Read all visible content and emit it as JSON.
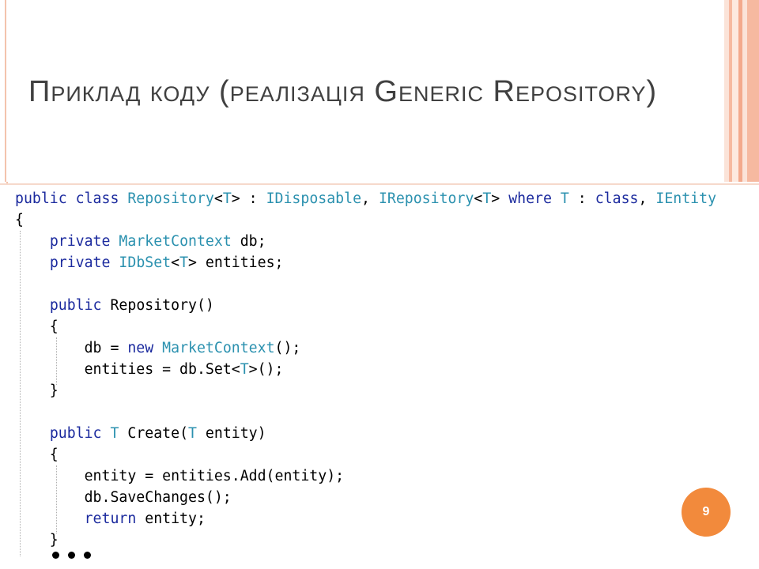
{
  "slide": {
    "title": "Приклад коду (реалізація Generic Repository)",
    "page_number": "9"
  },
  "code": {
    "lines": [
      [
        [
          "public",
          "kw"
        ],
        [
          " ",
          ""
        ],
        [
          "class",
          "kw"
        ],
        [
          " ",
          ""
        ],
        [
          "Repository",
          "ty"
        ],
        [
          "<",
          ""
        ],
        [
          "T",
          "ty"
        ],
        [
          "> : ",
          ""
        ],
        [
          "IDisposable",
          "ty"
        ],
        [
          ", ",
          ""
        ],
        [
          "IRepository",
          "ty"
        ],
        [
          "<",
          ""
        ],
        [
          "T",
          "ty"
        ],
        [
          "> ",
          ""
        ],
        [
          "where",
          "kw"
        ],
        [
          " ",
          ""
        ],
        [
          "T",
          "ty"
        ],
        [
          " : ",
          ""
        ],
        [
          "class",
          "kw"
        ],
        [
          ", ",
          ""
        ],
        [
          "IEntity",
          "ty"
        ]
      ],
      [
        [
          "{",
          ""
        ]
      ],
      [
        [
          "    ",
          ""
        ],
        [
          "private",
          "kw"
        ],
        [
          " ",
          ""
        ],
        [
          "MarketContext",
          "ty"
        ],
        [
          " db;",
          ""
        ]
      ],
      [
        [
          "    ",
          ""
        ],
        [
          "private",
          "kw"
        ],
        [
          " ",
          ""
        ],
        [
          "IDbSet",
          "ty"
        ],
        [
          "<",
          ""
        ],
        [
          "T",
          "ty"
        ],
        [
          "> entities;",
          ""
        ]
      ],
      [
        [
          "",
          ""
        ]
      ],
      [
        [
          "    ",
          ""
        ],
        [
          "public",
          "kw"
        ],
        [
          " Repository()",
          ""
        ]
      ],
      [
        [
          "    {",
          ""
        ]
      ],
      [
        [
          "        db = ",
          ""
        ],
        [
          "new",
          "kw"
        ],
        [
          " ",
          ""
        ],
        [
          "MarketContext",
          "ty"
        ],
        [
          "();",
          ""
        ]
      ],
      [
        [
          "        entities = db.Set<",
          ""
        ],
        [
          "T",
          "ty"
        ],
        [
          ">();",
          ""
        ]
      ],
      [
        [
          "    }",
          ""
        ]
      ],
      [
        [
          "",
          ""
        ]
      ],
      [
        [
          "    ",
          ""
        ],
        [
          "public",
          "kw"
        ],
        [
          " ",
          ""
        ],
        [
          "T",
          "ty"
        ],
        [
          " Create(",
          ""
        ],
        [
          "T",
          "ty"
        ],
        [
          " entity)",
          ""
        ]
      ],
      [
        [
          "    {",
          ""
        ]
      ],
      [
        [
          "        entity = entities.Add(entity);",
          ""
        ]
      ],
      [
        [
          "        db.SaveChanges();",
          ""
        ]
      ],
      [
        [
          "        ",
          ""
        ],
        [
          "return",
          "kw"
        ],
        [
          " entity;",
          ""
        ]
      ],
      [
        [
          "    }",
          ""
        ]
      ]
    ]
  },
  "colors": {
    "keyword": "#1b2a9e",
    "type": "#2b91af",
    "accent": "#f28a3c",
    "frame": "#f3c3ad"
  },
  "decor": {
    "stripes": [
      "#fbe3d8",
      "#f6b9a0",
      "#fde9df",
      "#f3a98c",
      "#fbe3d8",
      "#f6b9a0"
    ],
    "ellipsis_icon": "three-dots"
  }
}
